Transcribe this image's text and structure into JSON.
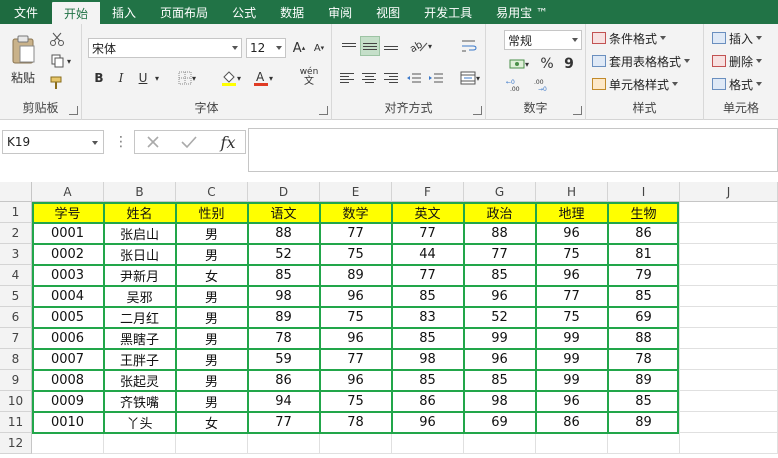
{
  "tabs": [
    "文件",
    "开始",
    "插入",
    "页面布局",
    "公式",
    "数据",
    "审阅",
    "视图",
    "开发工具",
    "易用宝 ™"
  ],
  "active_tab": "开始",
  "ribbon": {
    "clipboard": {
      "label": "剪贴板",
      "paste": "粘贴"
    },
    "font": {
      "label": "字体",
      "font_name": "宋体",
      "font_size": "12",
      "bold": "B",
      "italic": "I",
      "underline": "U",
      "wen": "wén"
    },
    "alignment": {
      "label": "对齐方式"
    },
    "number": {
      "label": "数字",
      "format": "常规",
      "percent": "%",
      "comma": "9"
    },
    "styles": {
      "label": "样式",
      "conditional": "条件格式",
      "table_format": "套用表格格式",
      "cell_styles": "单元格样式"
    },
    "cells": {
      "label": "单元格",
      "insert": "插入",
      "delete": "删除",
      "format": "格式"
    }
  },
  "formula_bar": {
    "name_box": "K19",
    "fx": "fx",
    "value": ""
  },
  "columns": [
    "A",
    "B",
    "C",
    "D",
    "E",
    "F",
    "G",
    "H",
    "I",
    "J"
  ],
  "rows": [
    "1",
    "2",
    "3",
    "4",
    "5",
    "6",
    "7",
    "8",
    "9",
    "10",
    "11",
    "12"
  ],
  "table": {
    "headers": [
      "学号",
      "姓名",
      "性别",
      "语文",
      "数学",
      "英文",
      "政治",
      "地理",
      "生物"
    ],
    "data": [
      [
        "0001",
        "张启山",
        "男",
        "88",
        "77",
        "77",
        "88",
        "96",
        "86"
      ],
      [
        "0002",
        "张日山",
        "男",
        "52",
        "75",
        "44",
        "77",
        "75",
        "81"
      ],
      [
        "0003",
        "尹新月",
        "女",
        "85",
        "89",
        "77",
        "85",
        "96",
        "79"
      ],
      [
        "0004",
        "吴邪",
        "男",
        "98",
        "96",
        "85",
        "96",
        "77",
        "85"
      ],
      [
        "0005",
        "二月红",
        "男",
        "89",
        "75",
        "83",
        "52",
        "75",
        "69"
      ],
      [
        "0006",
        "黑瞎子",
        "男",
        "78",
        "96",
        "85",
        "99",
        "99",
        "88"
      ],
      [
        "0007",
        "王胖子",
        "男",
        "59",
        "77",
        "98",
        "96",
        "99",
        "78"
      ],
      [
        "0008",
        "张起灵",
        "男",
        "86",
        "96",
        "85",
        "85",
        "99",
        "89"
      ],
      [
        "0009",
        "齐铁嘴",
        "男",
        "94",
        "75",
        "86",
        "98",
        "96",
        "85"
      ],
      [
        "0010",
        "丫头",
        "女",
        "77",
        "78",
        "96",
        "69",
        "86",
        "89"
      ]
    ]
  },
  "colors": {
    "excel_green": "#217346",
    "table_border": "#22a64a",
    "header_fill": "#ffff00"
  }
}
